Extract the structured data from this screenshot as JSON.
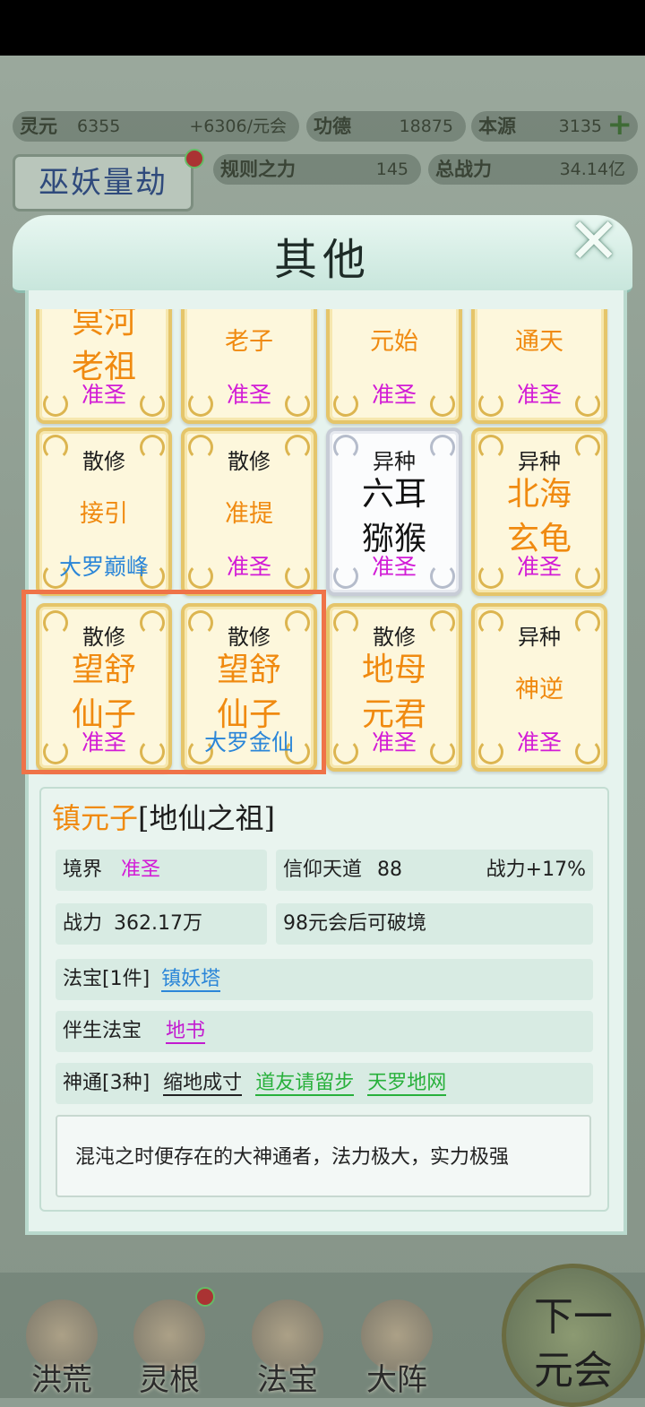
{
  "hud": {
    "lingyuan_label": "灵元",
    "lingyuan_value": "6355",
    "lingyuan_rate": "+6306/元会",
    "gongde_label": "功德",
    "gongde_value": "18875",
    "benyuan_label": "本源",
    "benyuan_value": "3135",
    "rules_label": "规则之力",
    "rules_value": "145",
    "power_label": "总战力",
    "power_value": "34.14亿",
    "mode_label": "巫妖量劫"
  },
  "bottom_nav": {
    "items": [
      {
        "label": "洪荒"
      },
      {
        "label": "灵根"
      },
      {
        "label": "法宝"
      },
      {
        "label": "大阵"
      }
    ],
    "next_line1": "下一",
    "next_line2": "元会"
  },
  "dialog": {
    "title": "其他",
    "close_icon": "close-x-icon"
  },
  "cards": [
    {
      "cat": "",
      "name1": "冥河",
      "name2": "老祖",
      "rank": "准圣",
      "rank_color": "purple",
      "style": "gold"
    },
    {
      "cat": "",
      "name1": "老子",
      "name2": "",
      "rank": "准圣",
      "rank_color": "purple",
      "style": "gold"
    },
    {
      "cat": "",
      "name1": "元始",
      "name2": "",
      "rank": "准圣",
      "rank_color": "purple",
      "style": "gold"
    },
    {
      "cat": "",
      "name1": "通天",
      "name2": "",
      "rank": "准圣",
      "rank_color": "purple",
      "style": "gold"
    },
    {
      "cat": "散修",
      "name1": "接引",
      "name2": "",
      "rank": "大罗巅峰",
      "rank_color": "blue",
      "style": "gold"
    },
    {
      "cat": "散修",
      "name1": "准提",
      "name2": "",
      "rank": "准圣",
      "rank_color": "purple",
      "style": "gold"
    },
    {
      "cat": "异种",
      "name1": "六耳",
      "name2": "猕猴",
      "rank": "准圣",
      "rank_color": "purple",
      "style": "white"
    },
    {
      "cat": "异种",
      "name1": "北海",
      "name2": "玄龟",
      "rank": "准圣",
      "rank_color": "purple",
      "style": "gold"
    },
    {
      "cat": "散修",
      "name1": "望舒",
      "name2": "仙子",
      "rank": "准圣",
      "rank_color": "purple",
      "style": "gold"
    },
    {
      "cat": "散修",
      "name1": "望舒",
      "name2": "仙子",
      "rank": "大罗金仙",
      "rank_color": "blue",
      "style": "gold"
    },
    {
      "cat": "散修",
      "name1": "地母",
      "name2": "元君",
      "rank": "准圣",
      "rank_color": "purple",
      "style": "gold"
    },
    {
      "cat": "异种",
      "name1": "神逆",
      "name2": "",
      "rank": "准圣",
      "rank_color": "purple",
      "style": "gold"
    }
  ],
  "detail": {
    "name": "镇元子",
    "title": "[地仙之祖]",
    "realm_label": "境界",
    "realm_value": "准圣",
    "faith_label": "信仰天道",
    "faith_value": "88",
    "faith_bonus": "战力+17%",
    "power_label": "战力",
    "power_value": "362.17万",
    "breakthrough": "98元会后可破境",
    "treasure_label": "法宝[1件]",
    "treasure_value": "镇妖塔",
    "companion_label": "伴生法宝",
    "companion_value": "地书",
    "skills_label": "神通[3种]",
    "skill1": "缩地成寸",
    "skill2": "道友请留步",
    "skill3": "天罗地网",
    "description": "混沌之时便存在的大神通者，法力极大，实力极强"
  }
}
